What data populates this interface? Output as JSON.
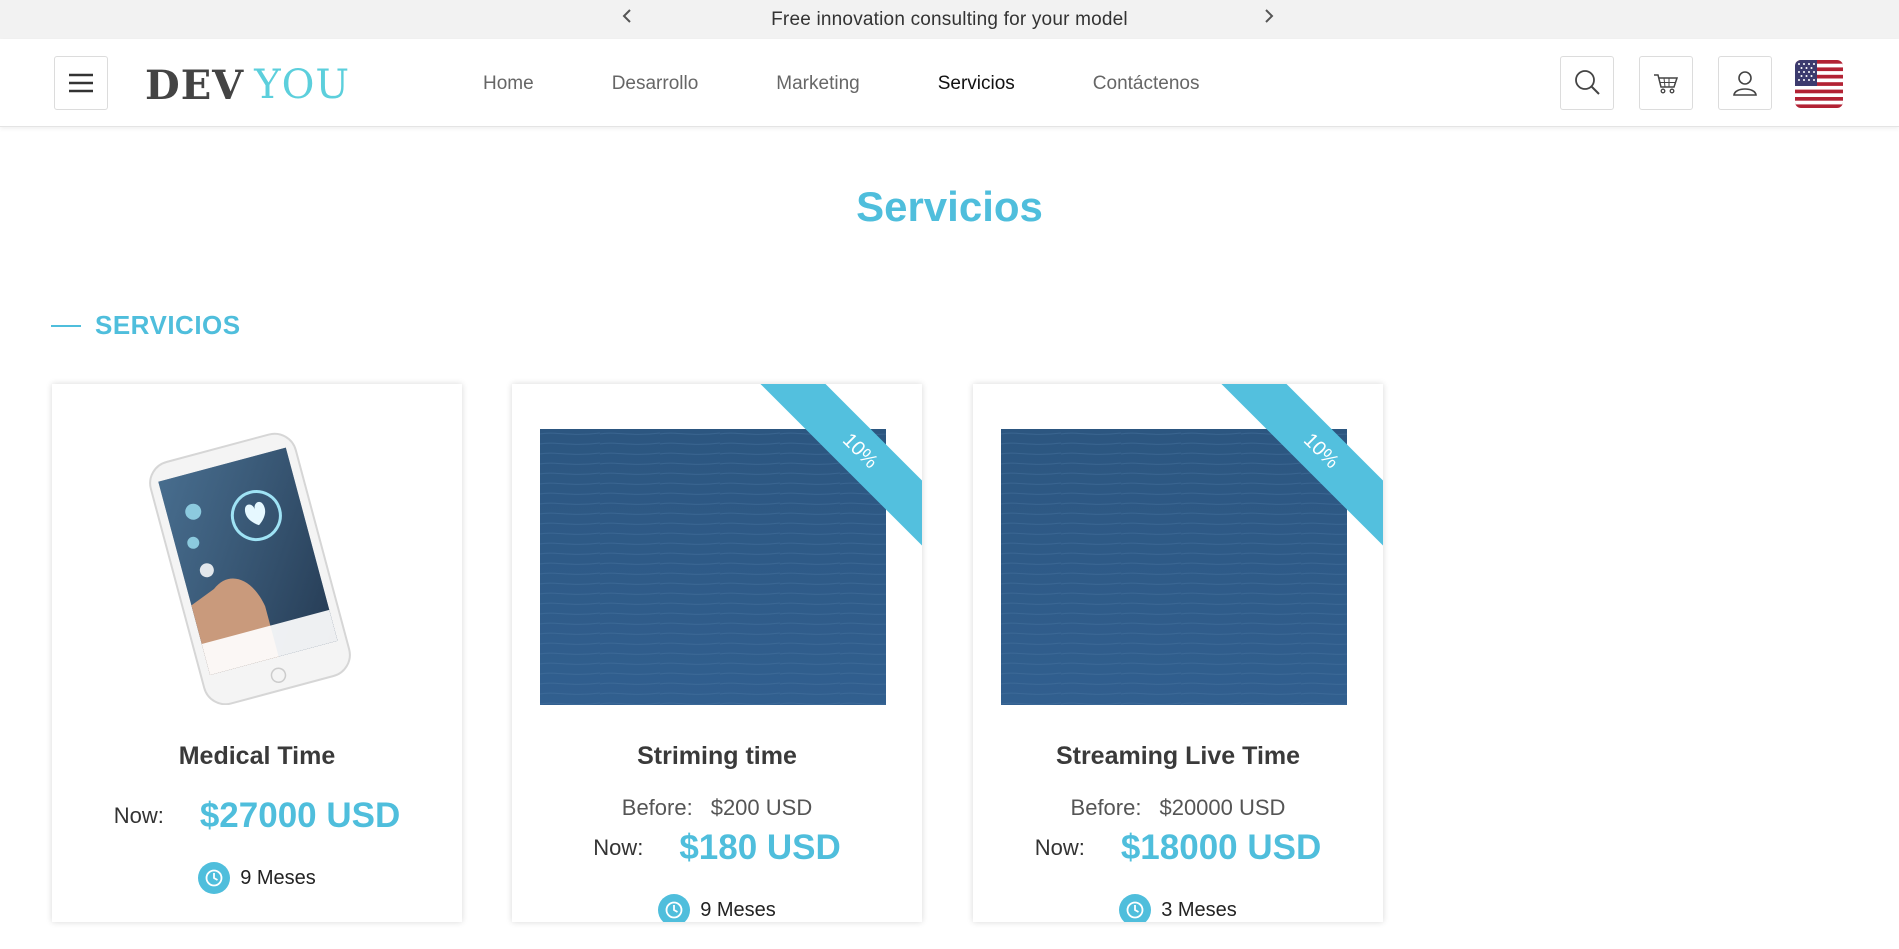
{
  "announcement": {
    "message": "Free innovation consulting for your model"
  },
  "header": {
    "logo": {
      "part1": "DEV",
      "part2": "YOU"
    },
    "nav": [
      {
        "label": "Home",
        "active": false
      },
      {
        "label": "Desarrollo",
        "active": false
      },
      {
        "label": "Marketing",
        "active": false
      },
      {
        "label": "Servicios",
        "active": true
      },
      {
        "label": "Contáctenos",
        "active": false
      }
    ],
    "icons": [
      "menu-icon",
      "search-icon",
      "cart-icon",
      "user-icon",
      "us-flag-icon"
    ]
  },
  "page": {
    "title": "Servicios",
    "section_label": "SERVICIOS"
  },
  "colors": {
    "accent": "#4fbedc",
    "logo_you": "#5ccfdc",
    "ocean": "#2f5b8a"
  },
  "cards": [
    {
      "name": "Medical Time",
      "now_label": "Now:",
      "now_price": "$27000 USD",
      "duration": "9 Meses"
    },
    {
      "name": "Striming time",
      "badge": "10%",
      "before_label": "Before:",
      "before_price": "$200 USD",
      "now_label": "Now:",
      "now_price": "$180 USD",
      "duration": "9 Meses"
    },
    {
      "name": "Streaming Live Time",
      "badge": "10%",
      "before_label": "Before:",
      "before_price": "$20000 USD",
      "now_label": "Now:",
      "now_price": "$18000 USD",
      "duration": "3 Meses"
    }
  ]
}
